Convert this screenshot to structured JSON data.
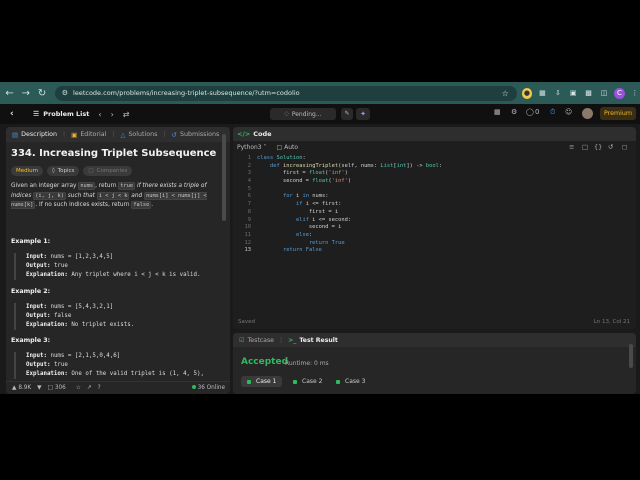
{
  "browser": {
    "url": "leetcode.com/problems/increasing-triplet-subsequence/?utm=codolio",
    "ext_badge": "C"
  },
  "nav": {
    "problem_list": "Problem List",
    "pending": "Pending...",
    "streak": "0",
    "premium": "Premium"
  },
  "left": {
    "tabs": [
      {
        "label": "Description"
      },
      {
        "label": "Editorial"
      },
      {
        "label": "Solutions"
      },
      {
        "label": "Submissions"
      }
    ],
    "title": "334. Increasing Triplet Subsequence",
    "tags": [
      "Medium",
      "Topics",
      "Companies"
    ],
    "desc": {
      "p1": "Given an integer array ",
      "c1": "nums",
      "p2": ", return ",
      "c2": "true",
      "p3": " if there exists a triple of indices ",
      "c3": "(i, j, k)",
      "p4": " such that ",
      "c4": "i < j < k",
      "p5": " and ",
      "c5": "nums[i] < nums[j] < nums[k]",
      "p6": ". If no such indices exists, return ",
      "c6": "false",
      "p7": "."
    },
    "examples": [
      {
        "title": "Example 1:",
        "input": "nums = [1,2,3,4,5]",
        "output": "true",
        "explanation": "Any triplet where i < j < k is valid."
      },
      {
        "title": "Example 2:",
        "input": "nums = [5,4,3,2,1]",
        "output": "false",
        "explanation": "No triplet exists."
      },
      {
        "title": "Example 3:",
        "input": "nums = [2,1,5,0,4,6]",
        "output": "true",
        "explanation": "One of the valid triplet is (1, 4, 5),"
      }
    ],
    "labels": {
      "input": "Input:",
      "output": "Output:",
      "explanation": "Explanation:"
    },
    "footer": {
      "likes": "8.9K",
      "comments": "306",
      "online": "36 Online"
    }
  },
  "code": {
    "header": "Code",
    "language": "Python3",
    "auto": "Auto",
    "saved": "Saved",
    "cursor": "Ln 13, Col 21"
  },
  "test": {
    "tabs": [
      "Testcase",
      "Test Result"
    ],
    "status": "Accepted",
    "runtime": "Runtime: 0 ms",
    "cases": [
      "Case 1",
      "Case 2",
      "Case 3"
    ]
  }
}
